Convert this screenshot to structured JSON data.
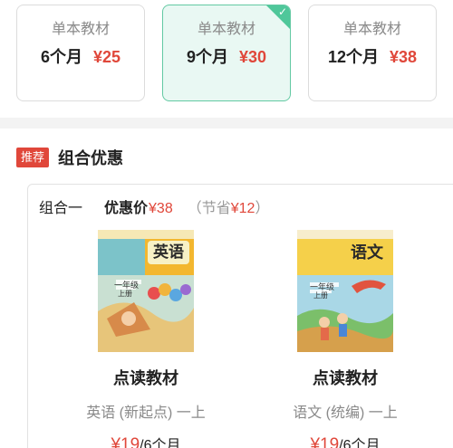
{
  "plans": [
    {
      "title": "单本教材",
      "duration": "6个月",
      "price": "¥25",
      "selected": false
    },
    {
      "title": "单本教材",
      "duration": "9个月",
      "price": "¥30",
      "selected": true
    },
    {
      "title": "单本教材",
      "duration": "12个月",
      "price": "¥38",
      "selected": false
    }
  ],
  "recommend": {
    "badge": "推荐",
    "title": "组合优惠"
  },
  "combo": {
    "name": "组合一",
    "price_label": "优惠价",
    "price": "¥38",
    "save_text": "（节省",
    "save_value": "¥12",
    "save_close": "）",
    "books": [
      {
        "cover_title": "英语",
        "cover_grade": "一年级",
        "cover_term": "上册",
        "type": "点读教材",
        "subtitle": "英语 (新起点) 一上",
        "price": "¥19",
        "per": "/6个月"
      },
      {
        "cover_title": "语文",
        "cover_grade": "一年级",
        "cover_term": "上册",
        "type": "点读教材",
        "subtitle": "语文 (统编) 一上",
        "price": "¥19",
        "per": "/6个月"
      }
    ]
  },
  "colors": {
    "accent_red": "#e0473a",
    "selected_green": "#4fc79a"
  },
  "icons": {
    "selected_check": "check-icon"
  }
}
